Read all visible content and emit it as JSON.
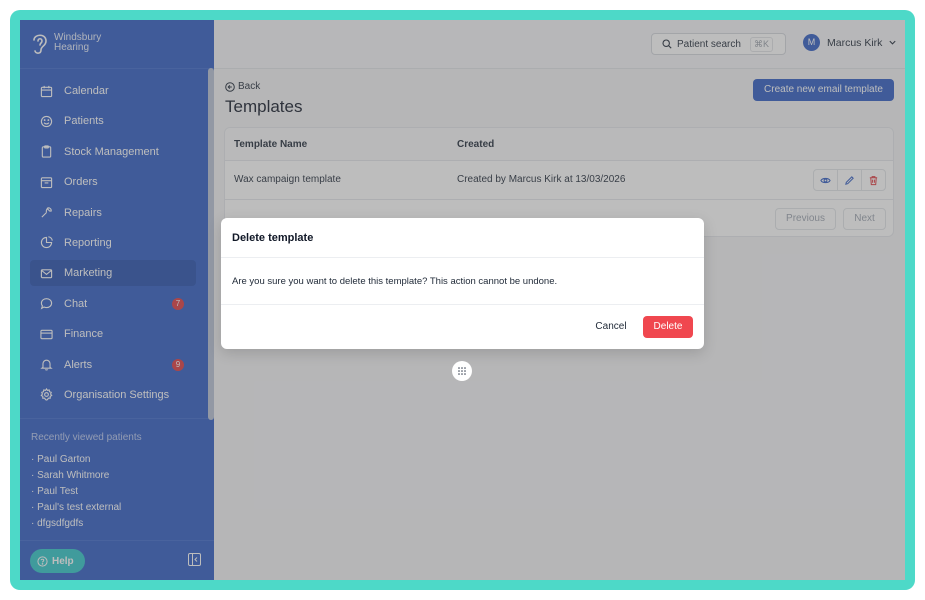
{
  "brand": {
    "line1": "Windsbury",
    "line2": "Hearing"
  },
  "sidebar": {
    "items": [
      {
        "label": "Calendar",
        "icon": "calendar-icon"
      },
      {
        "label": "Patients",
        "icon": "smiley-icon"
      },
      {
        "label": "Stock Management",
        "icon": "clipboard-icon"
      },
      {
        "label": "Orders",
        "icon": "box-icon"
      },
      {
        "label": "Repairs",
        "icon": "wrench-icon"
      },
      {
        "label": "Reporting",
        "icon": "pie-chart-icon"
      },
      {
        "label": "Marketing",
        "icon": "mail-icon",
        "active": true
      },
      {
        "label": "Chat",
        "icon": "chat-bubble-icon",
        "badge": "7"
      },
      {
        "label": "Finance",
        "icon": "credit-card-icon"
      },
      {
        "label": "Alerts",
        "icon": "bell-icon",
        "badge": "9"
      },
      {
        "label": "Organisation Settings",
        "icon": "gear-icon"
      }
    ],
    "recent_title": "Recently viewed patients",
    "recent": [
      "· Paul Garton",
      "· Sarah Whitmore",
      "· Paul Test",
      "· Paul's test external",
      "· dfgsdfgdfs"
    ],
    "help_label": "Help"
  },
  "topbar": {
    "search_label": "Patient search",
    "search_shortcut": "⌘K",
    "user_initial": "M",
    "user_name": "Marcus Kirk"
  },
  "main": {
    "back_label": "Back",
    "title": "Templates",
    "create_label": "Create new email template",
    "table": {
      "headers": [
        "Template Name",
        "Created"
      ],
      "rows": [
        {
          "name": "Wax campaign template",
          "created": "Created by Marcus Kirk at 13/03/2026"
        }
      ]
    },
    "pagination": {
      "previous": "Previous",
      "next": "Next"
    }
  },
  "modal": {
    "title": "Delete template",
    "body": "Are you sure you want to delete this template? This action cannot be undone.",
    "cancel_label": "Cancel",
    "delete_label": "Delete"
  },
  "colors": {
    "frame": "#4dd9c8",
    "sidebar": "#2f5cc4",
    "primary": "#2f5cc4",
    "danger": "#f0474f",
    "badge": "#e0393e",
    "help": "#2fc6c9"
  }
}
